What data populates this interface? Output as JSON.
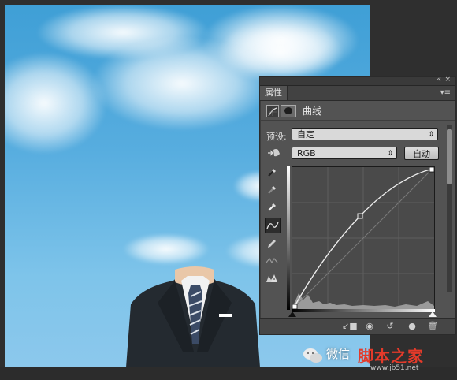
{
  "panel": {
    "tab_label": "属性",
    "title": "曲线",
    "preset_label": "预设:",
    "preset_value": "自定",
    "channel_value": "RGB",
    "auto_button": "自动"
  },
  "watermark": {
    "text": "微信",
    "brand": "脚本之家",
    "url": "www.jb51.net"
  },
  "colors": {
    "sky": "#57addf",
    "panel_bg": "#535353",
    "accent_red": "#e33a2a"
  },
  "icons": [
    "expand-icon",
    "close-icon",
    "panel-menu-icon",
    "curves-adjustment-icon",
    "mask-icon",
    "hand-target-icon",
    "eyedropper-black-icon",
    "eyedropper-gray-icon",
    "eyedropper-white-icon",
    "curve-tool-icon",
    "pencil-tool-icon",
    "smooth-tool-icon",
    "clipping-warning-icon",
    "clip-layer-icon",
    "visibility-view-icon",
    "reset-icon",
    "eye-icon",
    "trash-icon"
  ]
}
